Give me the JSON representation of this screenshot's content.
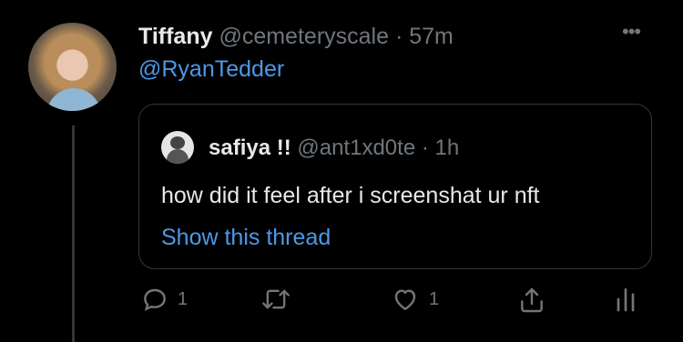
{
  "tweet": {
    "display_name": "Tiffany",
    "handle": "@cemeteryscale",
    "separator": "·",
    "time": "57m",
    "reply_to": "@RyanTedder"
  },
  "quoted": {
    "display_name": "safiya !!",
    "handle": "@ant1xd0te",
    "separator": "·",
    "time": "1h",
    "text": "how did it feel after i screenshat ur nft",
    "show_thread": "Show this thread"
  },
  "actions": {
    "reply_count": "1",
    "like_count": "1"
  },
  "colors": {
    "accent": "#4b99e9",
    "muted": "#71767b",
    "border": "#333639",
    "background": "#000000"
  },
  "icons": [
    "more-icon",
    "reply-icon",
    "retweet-icon",
    "like-icon",
    "share-icon",
    "analytics-icon"
  ]
}
